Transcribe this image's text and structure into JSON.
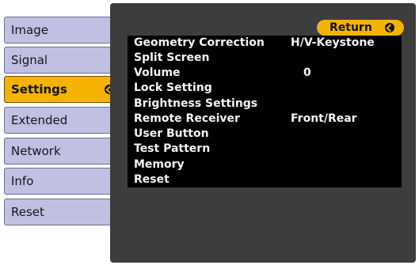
{
  "menu": {
    "tabs": [
      {
        "label": "Image"
      },
      {
        "label": "Signal"
      },
      {
        "label": "Settings"
      },
      {
        "label": "Extended"
      },
      {
        "label": "Network"
      },
      {
        "label": "Info"
      },
      {
        "label": "Reset"
      }
    ],
    "selected": "Settings"
  },
  "panel": {
    "return_label": "Return",
    "items": [
      {
        "label": "Geometry Correction",
        "value": "H/V-Keystone"
      },
      {
        "label": "Split Screen",
        "value": ""
      },
      {
        "label": "Volume",
        "value": "0"
      },
      {
        "label": "Lock Setting",
        "value": ""
      },
      {
        "label": "Brightness Settings",
        "value": ""
      },
      {
        "label": "Remote Receiver",
        "value": "Front/Rear"
      },
      {
        "label": "User Button",
        "value": ""
      },
      {
        "label": "Test Pattern",
        "value": ""
      },
      {
        "label": "Memory",
        "value": ""
      },
      {
        "label": "Reset",
        "value": ""
      }
    ]
  },
  "colors": {
    "tab_bg": "#bfc0e2",
    "accent": "#f3b300",
    "panel_bg": "#3d3d3d",
    "list_bg": "#000000"
  },
  "icons": {
    "enter": "enter-icon"
  }
}
